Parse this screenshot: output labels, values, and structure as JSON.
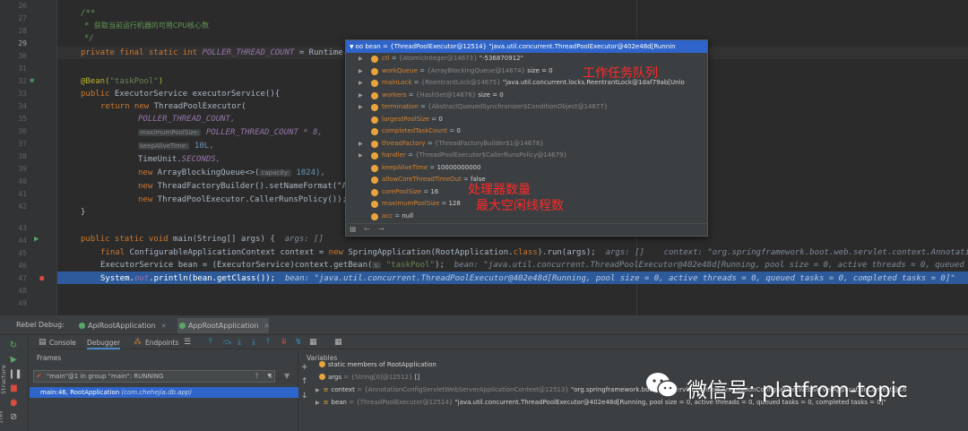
{
  "editor": {
    "line_numbers": [
      "26",
      "27",
      "28",
      "29",
      "30",
      "31",
      "32",
      "33",
      "34",
      "35",
      "36",
      "37",
      "38",
      "39",
      "40",
      "41",
      "42",
      "43",
      "44",
      "45",
      "46",
      "47",
      "48",
      "49"
    ],
    "comment_open": "/**",
    "comment_text": "获取当前运行机器的可用CPU核心数",
    "comment_close": "*/",
    "field_kw": "private final static int",
    "field_name": "POLLER_THREAD_COUNT",
    "field_rest": " = Runtime.",
    "bean_annotation": "@Bean(",
    "bean_name": "\"taskPool\"",
    "bean_close": ")",
    "method_kw": "public",
    "method_sig": " ExecutorService executorService(){",
    "return_kw": "return new",
    "return_rest": " ThreadPoolExecutor(",
    "arg_core": "POLLER_THREAD_COUNT,",
    "hint_max": "maximumPoolSize:",
    "arg_max": "POLLER_THREAD_COUNT * 8,",
    "hint_keep": "keepAliveTime:",
    "arg_keep": "10L,",
    "arg_unit_a": "TimeUnit.",
    "arg_unit_b": "SECONDS,",
    "new_kw": "new",
    "arg_queue_a": " ArrayBlockingQueue<>(",
    "hint_capacity": "capacity:",
    "arg_queue_b": "1024),",
    "arg_factory": " ThreadFactoryBuilder().setNameFormat(\"A",
    "arg_policy": " ThreadPoolExecutor.CallerRunsPolicy());",
    "close_brace": "}",
    "main_kw": "public static void",
    "main_sig": " main(String[] args) {",
    "main_hint": "args: []",
    "ctx_kw": "final",
    "ctx_rest": " ConfigurableApplicationContext context = ",
    "ctx_new": "new",
    "ctx_call": " SpringApplication(RootApplication.",
    "ctx_class": "class",
    "ctx_run": ").run(args);",
    "ctx_hint": "args: []    context: \"org.springframework.boot.web.servlet.context.Annotatio",
    "exec_text": "ExecutorService bean = (ExecutorService)context.getBean(",
    "hint_s": "s:",
    "exec_str": "\"taskPool\"",
    "exec_end": ");",
    "exec_hint": "bean: \"java.util.concurrent.ThreadPoolExecutor@402e48d[Running, pool size = 0, active threads = 0, queued t",
    "print_a": "System.",
    "print_out": "out",
    "print_b": ".println(bean.getClass());",
    "print_hint": "bean: \"java.util.concurrent.ThreadPoolExecutor@402e48d[Running, pool size = 0, active threads = 0, queued tasks = 0, completed tasks = 0]\""
  },
  "popup": {
    "header": "oo bean = {ThreadPoolExecutor@12514} \"java.util.concurrent.ThreadPoolExecutor@402e48d[Runnin",
    "rows": [
      {
        "arrow": true,
        "name": "ctl",
        "ref": "{AtomicInteger@14673}",
        "val": "\"-536870912\""
      },
      {
        "arrow": true,
        "name": "workQueue",
        "ref": "{ArrayBlockingQueue@14674}",
        "val": "size = 0"
      },
      {
        "arrow": true,
        "name": "mainLock",
        "ref": "{ReentrantLock@14675}",
        "val": "\"java.util.concurrent.locks.ReentrantLock@1daf79ab[Unlo"
      },
      {
        "arrow": true,
        "name": "workers",
        "ref": "{HashSet@14676}",
        "val": "size = 0"
      },
      {
        "arrow": true,
        "name": "termination",
        "ref": "{AbstractQueuedSynchronizer$ConditionObject@14677}",
        "val": ""
      },
      {
        "arrow": false,
        "name": "largestPoolSize",
        "ref": "",
        "val": "0"
      },
      {
        "arrow": false,
        "name": "completedTaskCount",
        "ref": "",
        "val": "0"
      },
      {
        "arrow": true,
        "name": "threadFactory",
        "ref": "{ThreadFactoryBuilder$1@14678}",
        "val": ""
      },
      {
        "arrow": true,
        "name": "handler",
        "ref": "{ThreadPoolExecutor$CallerRunsPolicy@14679}",
        "val": ""
      },
      {
        "arrow": false,
        "name": "keepAliveTime",
        "ref": "",
        "val": "10000000000"
      },
      {
        "arrow": false,
        "name": "allowCoreThreadTimeOut",
        "ref": "",
        "val": "false"
      },
      {
        "arrow": false,
        "name": "corePoolSize",
        "ref": "",
        "val": "16"
      },
      {
        "arrow": false,
        "name": "maximumPoolSize",
        "ref": "",
        "val": "128"
      },
      {
        "arrow": false,
        "name": "acc",
        "ref": "",
        "val": "null"
      }
    ],
    "note_queue": "工作任务队列",
    "note_core": "处理器数量",
    "note_max": "最大空闲线程数"
  },
  "debug": {
    "label": "Rebel Debug:",
    "sessions": [
      "ApiRootApplication",
      "AppRootApplication"
    ],
    "tabs": [
      "Console",
      "Debugger",
      "Endpoints"
    ],
    "frames_title": "Frames",
    "thread": "\"main\"@1 in group \"main\": RUNNING",
    "frame_method": "main:46, RootApplication",
    "frame_pkg": "(com.chehejia.db.app)",
    "variables_title": "Variables",
    "variables": [
      {
        "arrow": false,
        "icon": "static",
        "name": "static members of RootApplication",
        "ref": "",
        "val": ""
      },
      {
        "arrow": false,
        "icon": "dot",
        "name": "args",
        "ref": "= {String[0]@12512}",
        "val": "[]"
      },
      {
        "arrow": true,
        "icon": "bar",
        "name": "context",
        "ref": "= {AnnotationConfigServletWebServerApplicationContext@12513}",
        "val": "\"org.springframework.boot.web.servlet.context.AnnotationConfigServletWebServerApplicationContext@16"
      },
      {
        "arrow": true,
        "icon": "bar",
        "name": "bean",
        "ref": "= {ThreadPoolExecutor@12514}",
        "val": "\"java.util.concurrent.ThreadPoolExecutor@402e48d[Running, pool size = 0, active threads = 0, queued tasks = 0, completed tasks = 0]\""
      }
    ],
    "left_strip": [
      "Structure",
      "ites"
    ]
  },
  "watermark": {
    "text": "微信号: platfrom-topic"
  },
  "colors": {
    "selection": "#2f65ca",
    "breakpoint_row": "#2d5a9a",
    "annotation_red": "#ff2a2a",
    "field_orange": "#d5822f"
  }
}
